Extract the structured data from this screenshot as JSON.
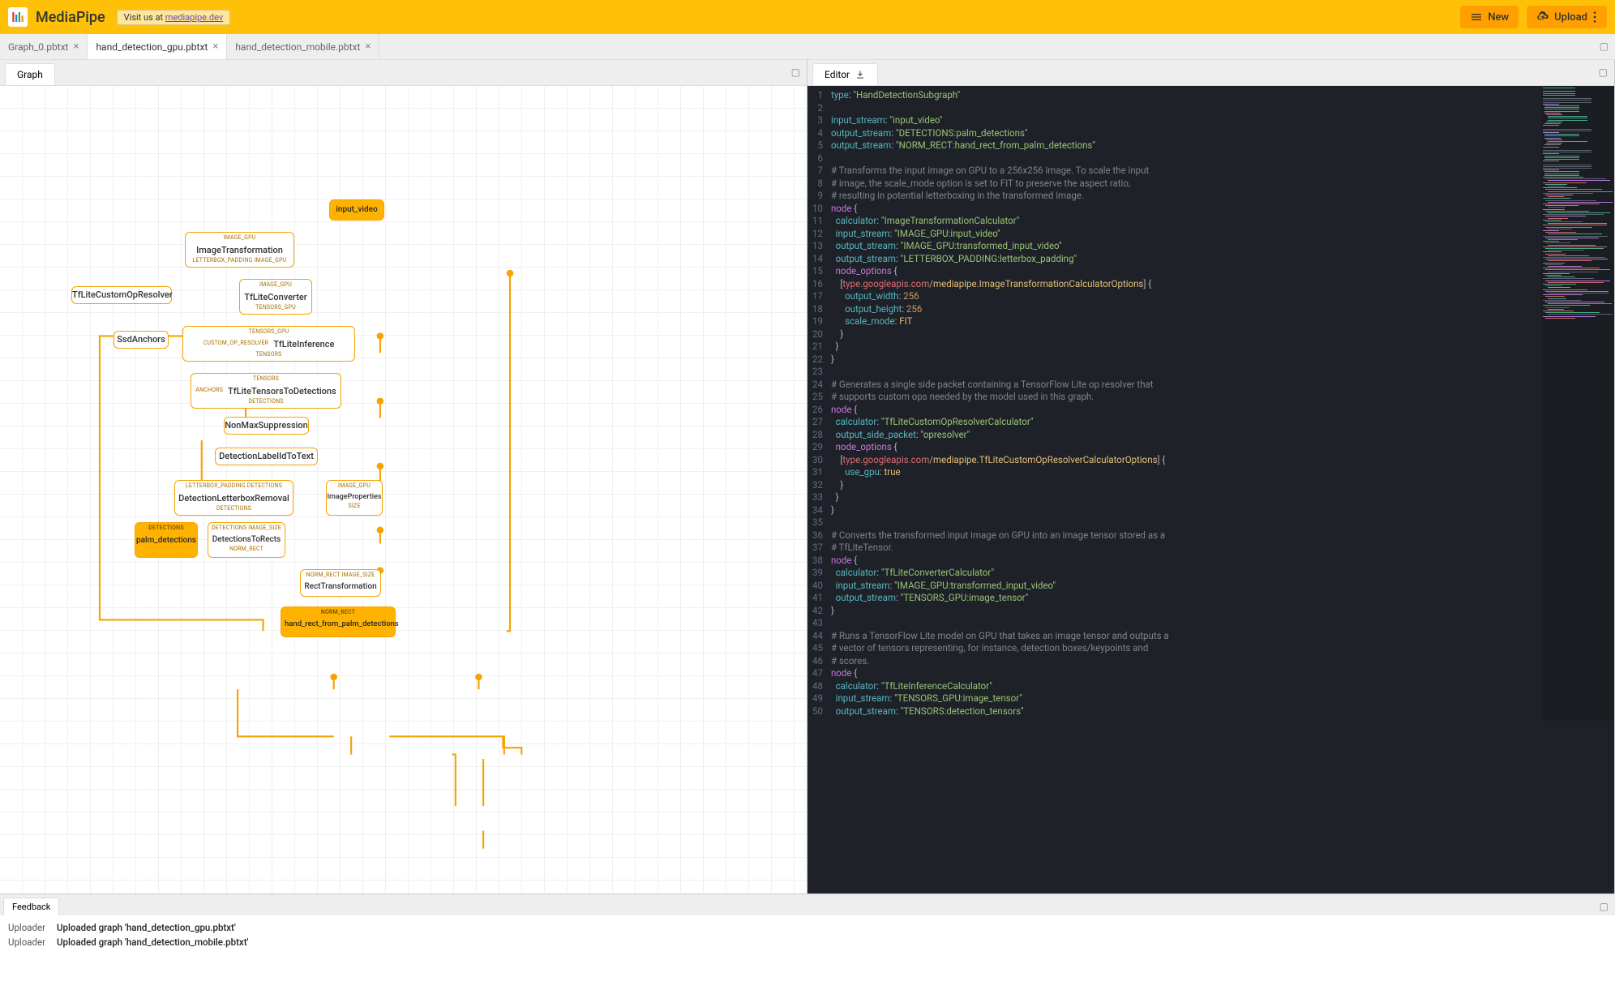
{
  "header": {
    "app_name": "MediaPipe",
    "visit_prefix": "Visit us at ",
    "visit_link": "mediapipe.dev",
    "new_label": "New",
    "upload_label": "Upload"
  },
  "file_tabs": [
    {
      "label": "Graph_0.pbtxt",
      "active": false
    },
    {
      "label": "hand_detection_gpu.pbtxt",
      "active": true
    },
    {
      "label": "hand_detection_mobile.pbtxt",
      "active": false
    }
  ],
  "left_panel": {
    "tab": "Graph"
  },
  "right_panel": {
    "tab": "Editor"
  },
  "graph": {
    "io_input": "input_video",
    "io_out1": "palm_detections",
    "io_out2": "hand_rect_from_palm_detections",
    "n1": {
      "title": "ImageTransformation",
      "top": "IMAGE_GPU",
      "bot": "LETTERBOX_PADDING   IMAGE_GPU"
    },
    "n2": {
      "title": "TfLiteConverter",
      "top": "IMAGE_GPU",
      "bot": "TENSORS_GPU"
    },
    "n3": {
      "title": "TfLiteCustomOpResolver"
    },
    "n4": {
      "title": "TfLiteInference",
      "top": "TENSORS_GPU",
      "left": "CUSTOM_OP_RESOLVER",
      "bot": "TENSORS"
    },
    "n5": {
      "title": "SsdAnchors"
    },
    "n6": {
      "title": "TfLiteTensorsToDetections",
      "top": "TENSORS",
      "left": "ANCHORS",
      "bot": "DETECTIONS"
    },
    "n7": {
      "title": "NonMaxSuppression"
    },
    "n8": {
      "title": "DetectionLabelIdToText"
    },
    "n9": {
      "title": "DetectionLetterboxRemoval",
      "top": "LETTERBOX_PADDING   DETECTIONS",
      "bot": "DETECTIONS"
    },
    "n10": {
      "title": "ImageProperties",
      "top": "IMAGE_GPU",
      "bot": "SIZE"
    },
    "n11": {
      "title": "DetectionsToRects",
      "top": "DETECTIONS   IMAGE_SIZE",
      "bot": "NORM_RECT",
      "out_top": "DETECTIONS"
    },
    "n12": {
      "title": "RectTransformation",
      "top": "NORM_RECT   IMAGE_SIZE",
      "out_top": "NORM_RECT"
    }
  },
  "code": [
    {
      "t": "kv",
      "k": "type",
      "v": "\"HandDetectionSubgraph\""
    },
    {
      "t": "blank"
    },
    {
      "t": "kv",
      "k": "input_stream",
      "v": "\"input_video\""
    },
    {
      "t": "kv",
      "k": "output_stream",
      "v": "\"DETECTIONS:palm_detections\""
    },
    {
      "t": "kv",
      "k": "output_stream",
      "v": "\"NORM_RECT:hand_rect_from_palm_detections\""
    },
    {
      "t": "blank"
    },
    {
      "t": "c",
      "v": "# Transforms the input image on GPU to a 256x256 image. To scale the input"
    },
    {
      "t": "c",
      "v": "# image, the scale_mode option is set to FIT to preserve the aspect ratio,"
    },
    {
      "t": "c",
      "v": "# resulting in potential letterboxing in the transformed image."
    },
    {
      "t": "open",
      "k": "node"
    },
    {
      "t": "kv",
      "k": "calculator",
      "v": "\"ImageTransformationCalculator\"",
      "i": 1
    },
    {
      "t": "kv",
      "k": "input_stream",
      "v": "\"IMAGE_GPU:input_video\"",
      "i": 1
    },
    {
      "t": "kv",
      "k": "output_stream",
      "v": "\"IMAGE_GPU:transformed_input_video\"",
      "i": 1
    },
    {
      "t": "kv",
      "k": "output_stream",
      "v": "\"LETTERBOX_PADDING:letterbox_padding\"",
      "i": 1
    },
    {
      "t": "open",
      "k": "node_options",
      "i": 1
    },
    {
      "t": "type",
      "ns": "type.googleapis.com",
      "id": "mediapipe.ImageTransformationCalculatorOptions",
      "i": 2
    },
    {
      "t": "kv",
      "k": "output_width",
      "v": "256",
      "n": true,
      "i": 3
    },
    {
      "t": "kv",
      "k": "output_height",
      "v": "256",
      "n": true,
      "i": 3
    },
    {
      "t": "kv",
      "k": "scale_mode",
      "v": "FIT",
      "id": true,
      "i": 3
    },
    {
      "t": "close",
      "i": 2
    },
    {
      "t": "close",
      "i": 1
    },
    {
      "t": "close"
    },
    {
      "t": "blank"
    },
    {
      "t": "c",
      "v": "# Generates a single side packet containing a TensorFlow Lite op resolver that"
    },
    {
      "t": "c",
      "v": "# supports custom ops needed by the model used in this graph."
    },
    {
      "t": "open",
      "k": "node"
    },
    {
      "t": "kv",
      "k": "calculator",
      "v": "\"TfLiteCustomOpResolverCalculator\"",
      "i": 1
    },
    {
      "t": "kv",
      "k": "output_side_packet",
      "v": "\"opresolver\"",
      "i": 1
    },
    {
      "t": "open",
      "k": "node_options",
      "i": 1
    },
    {
      "t": "type",
      "ns": "type.googleapis.com",
      "id": "mediapipe.TfLiteCustomOpResolverCalculatorOptions",
      "i": 2
    },
    {
      "t": "kv",
      "k": "use_gpu",
      "v": "true",
      "id": true,
      "i": 3
    },
    {
      "t": "close",
      "i": 2
    },
    {
      "t": "close",
      "i": 1
    },
    {
      "t": "close"
    },
    {
      "t": "blank"
    },
    {
      "t": "c",
      "v": "# Converts the transformed input image on GPU into an image tensor stored as a"
    },
    {
      "t": "c",
      "v": "# TfLiteTensor."
    },
    {
      "t": "open",
      "k": "node"
    },
    {
      "t": "kv",
      "k": "calculator",
      "v": "\"TfLiteConverterCalculator\"",
      "i": 1
    },
    {
      "t": "kv",
      "k": "input_stream",
      "v": "\"IMAGE_GPU:transformed_input_video\"",
      "i": 1
    },
    {
      "t": "kv",
      "k": "output_stream",
      "v": "\"TENSORS_GPU:image_tensor\"",
      "i": 1
    },
    {
      "t": "close"
    },
    {
      "t": "blank"
    },
    {
      "t": "c",
      "v": "# Runs a TensorFlow Lite model on GPU that takes an image tensor and outputs a"
    },
    {
      "t": "c",
      "v": "# vector of tensors representing, for instance, detection boxes/keypoints and"
    },
    {
      "t": "c",
      "v": "# scores."
    },
    {
      "t": "open",
      "k": "node"
    },
    {
      "t": "kv",
      "k": "calculator",
      "v": "\"TfLiteInferenceCalculator\"",
      "i": 1
    },
    {
      "t": "kv",
      "k": "input_stream",
      "v": "\"TENSORS_GPU:image_tensor\"",
      "i": 1
    },
    {
      "t": "kv",
      "k": "output_stream",
      "v": "\"TENSORS:detection_tensors\"",
      "i": 1
    }
  ],
  "feedback": {
    "tab": "Feedback",
    "rows": [
      {
        "tag": "Uploader",
        "msg": "Uploaded graph 'hand_detection_gpu.pbtxt'"
      },
      {
        "tag": "Uploader",
        "msg": "Uploaded graph 'hand_detection_mobile.pbtxt'"
      }
    ]
  }
}
